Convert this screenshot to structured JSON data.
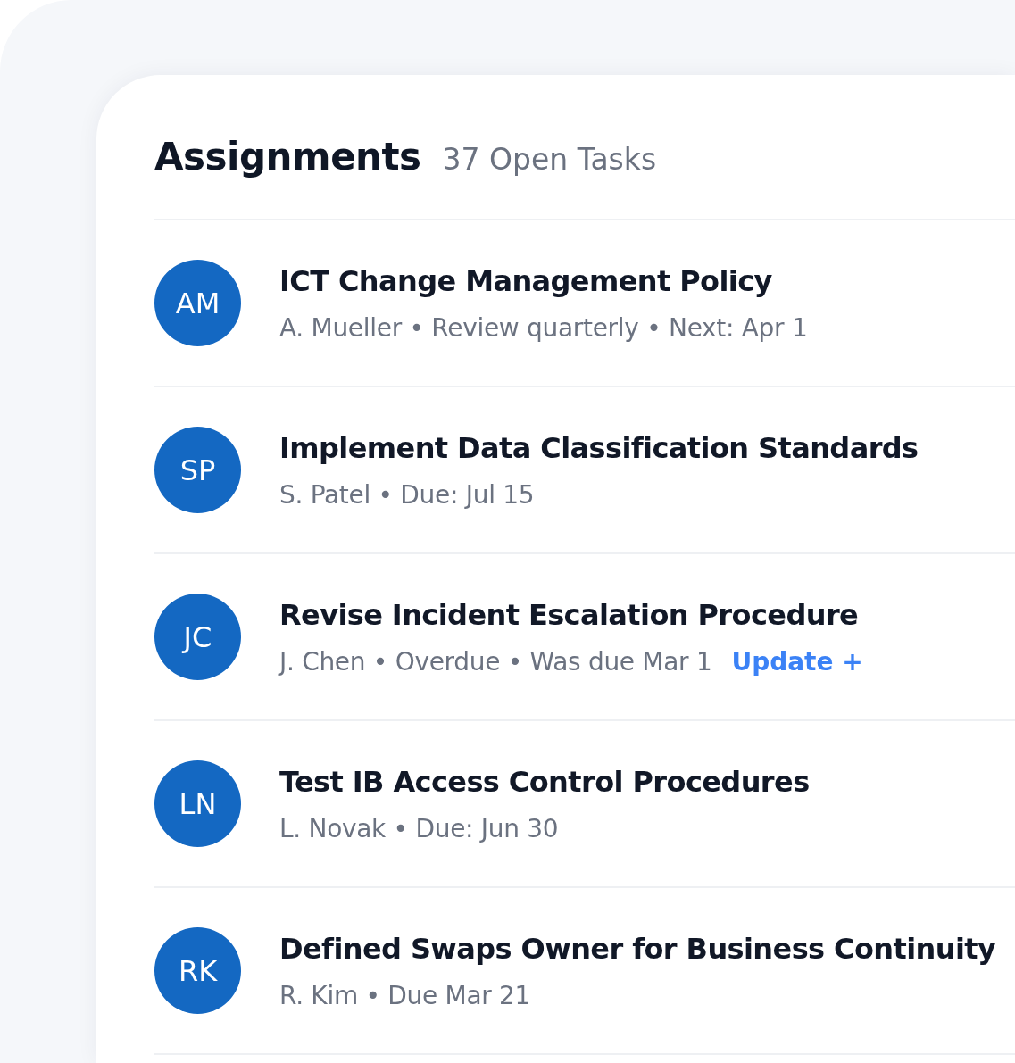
{
  "header": {
    "title": "Assignments",
    "count": "37 Open Tasks"
  },
  "tasks": [
    {
      "initials": "AM",
      "title": "ICT Change Management Policy",
      "meta": "A. Mueller • Review quarterly • Next: Apr 1"
    },
    {
      "initials": "SP",
      "title": "Implement Data Classification Standards",
      "meta": "S. Patel • Due: Jul 15"
    },
    {
      "initials": "JC",
      "title": "Revise Incident Escalation Procedure",
      "meta": "J. Chen • Overdue • Was due Mar 1",
      "action": "Update +"
    },
    {
      "initials": "LN",
      "title": "Test IB Access Control Procedures",
      "meta": "L. Novak • Due: Jun 30"
    },
    {
      "initials": "RK",
      "title": "Defined Swaps Owner for Business Continuity",
      "meta": "R. Kim • Due Mar 21"
    }
  ]
}
